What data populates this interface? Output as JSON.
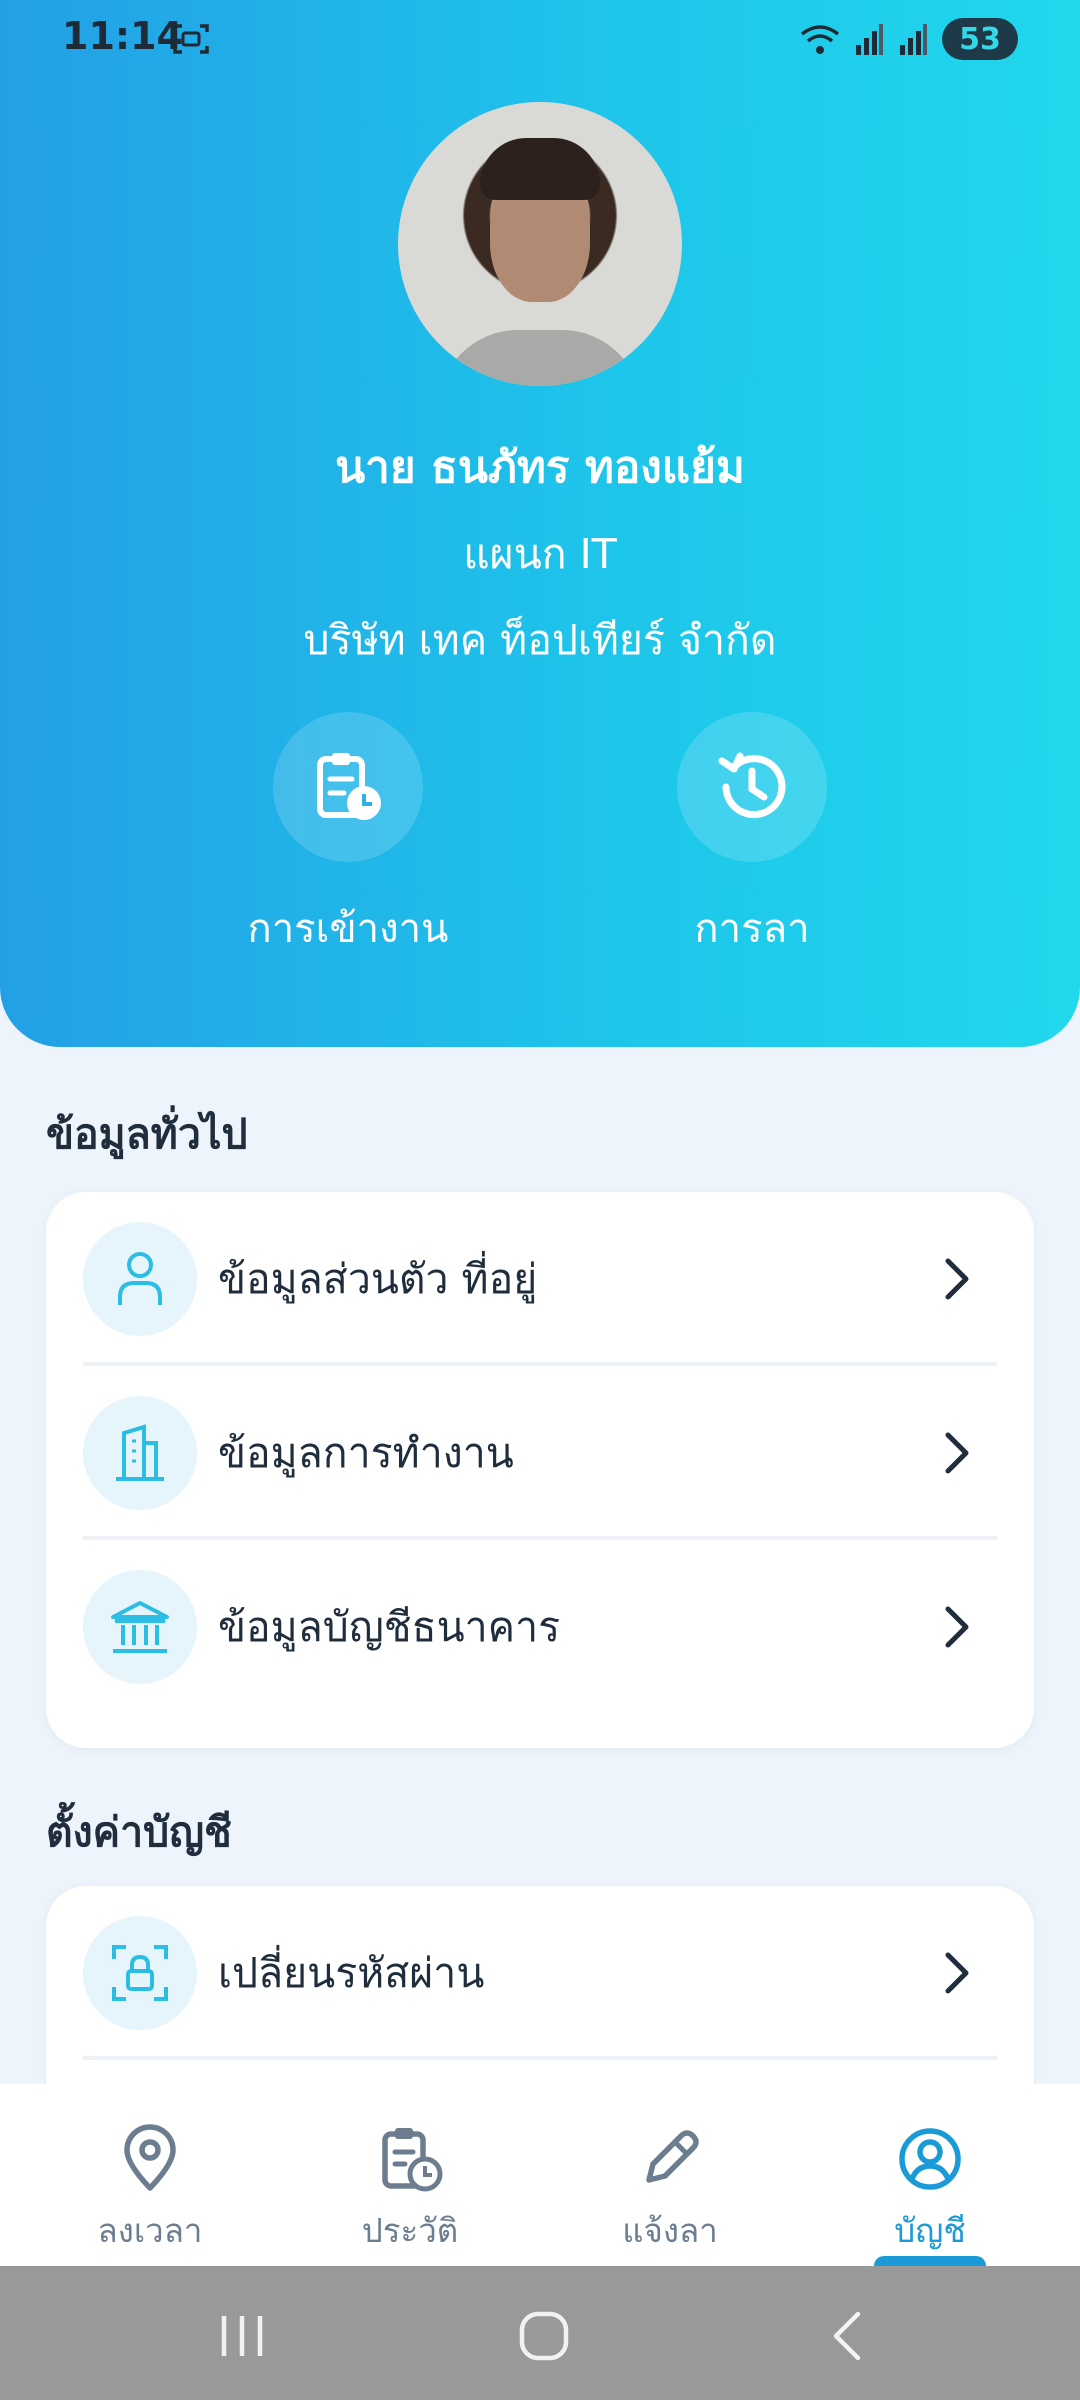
{
  "status": {
    "time": "11:14",
    "battery": "53"
  },
  "profile": {
    "name": "นาย ธนภัทร ทองแย้ม",
    "department": "แผนก IT",
    "company": "บริษัท เทค ท็อปเทียร์ จำกัด"
  },
  "quick_actions": [
    {
      "label": "การเข้างาน",
      "icon": "clipboard-clock-icon"
    },
    {
      "label": "การลา",
      "icon": "history-icon"
    }
  ],
  "general": {
    "title": "ข้อมูลทั่วไป",
    "items": [
      {
        "label": "ข้อมูลส่วนตัว ที่อยู่",
        "icon": "person-icon"
      },
      {
        "label": "ข้อมูลการทำงาน",
        "icon": "building-icon"
      },
      {
        "label": "ข้อมูลบัญชีธนาคาร",
        "icon": "bank-icon"
      }
    ]
  },
  "account_settings": {
    "title": "ตั้งค่าบัญชี",
    "items": [
      {
        "label": "เปลี่ยนรหัสผ่าน",
        "icon": "lock-scan-icon"
      }
    ]
  },
  "bottom_nav": {
    "items": [
      {
        "label": "ลงเวลา",
        "icon": "location-pin-icon",
        "active": false
      },
      {
        "label": "ประวัติ",
        "icon": "clipboard-clock-icon",
        "active": false
      },
      {
        "label": "แจ้งลา",
        "icon": "pencil-icon",
        "active": false
      },
      {
        "label": "บัญชี",
        "icon": "user-circle-icon",
        "active": true
      }
    ]
  },
  "colors": {
    "header_gradient_start": "#239fe6",
    "header_gradient_end": "#20d8ec",
    "accent": "#1a9ad6",
    "icon_tint": "#2bbde3",
    "text_primary": "#1f2d3d",
    "nav_inactive": "#6c7d90"
  }
}
